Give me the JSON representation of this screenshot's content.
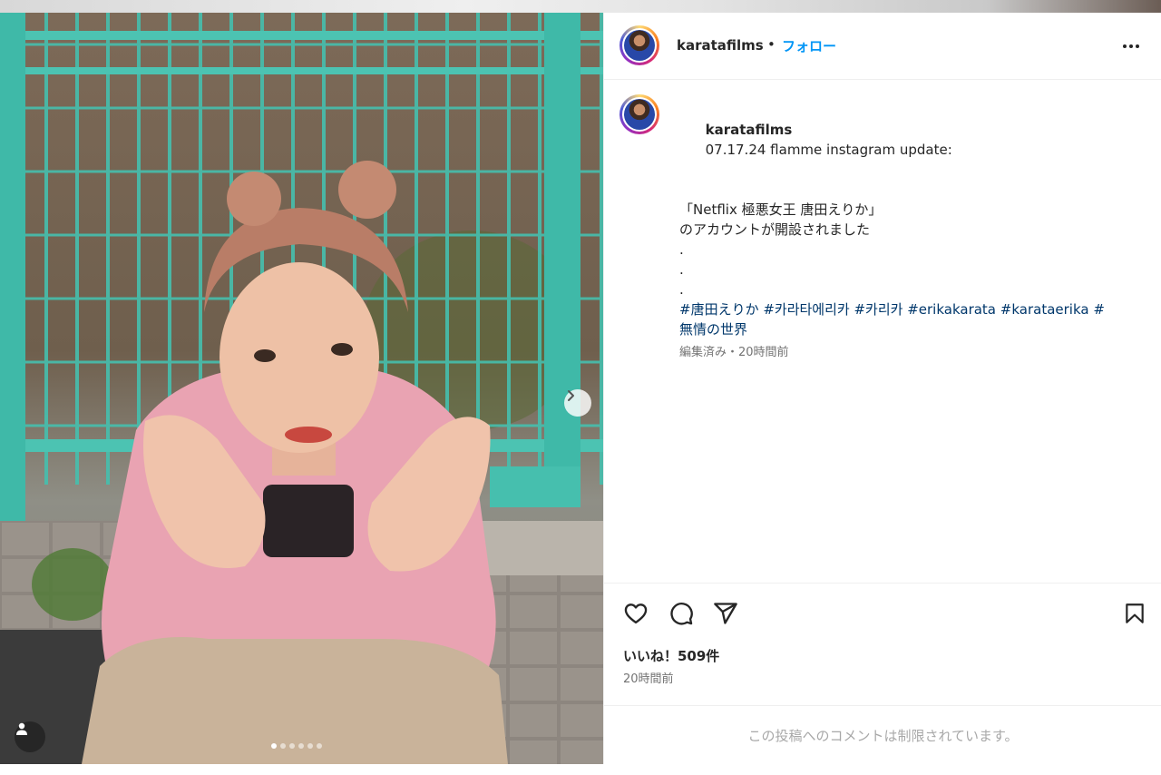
{
  "post": {
    "username": "karatafilms",
    "separator": "•",
    "follow_label": "フォロー",
    "more_icon": "more-horizontal-icon",
    "photo_alt": "photo carousel slide",
    "carousel": {
      "total_slides": 6,
      "active_index": 0,
      "next_icon": "chevron-right-icon"
    },
    "user_tag_icon": "user-tag-icon"
  },
  "caption": {
    "username": "karatafilms",
    "first_line": "07.17.24 flamme instagram update:",
    "lines": [
      "",
      "「Netflix 極悪女王 唐田えりか」",
      "のアカウントが開設されました",
      ".",
      ".",
      "."
    ],
    "hashtags_line1": "#唐田えりか #카라타에리카 #카리카 #erikakarata #karataerika #",
    "hashtags_line2": "無情の世界",
    "meta": "編集済み・20時間前"
  },
  "actions": {
    "like_icon": "heart-icon",
    "comment_icon": "comment-icon",
    "share_icon": "share-icon",
    "save_icon": "bookmark-icon",
    "likes_text": "いいね！509件",
    "time_text": "20時間前"
  },
  "comments": {
    "limited_text": "この投稿へのコメントは制限されています。"
  },
  "colors": {
    "follow_blue": "#0095f6",
    "hashtag": "#00376b",
    "muted": "#737373",
    "fence_teal": "#3fb9a8"
  }
}
